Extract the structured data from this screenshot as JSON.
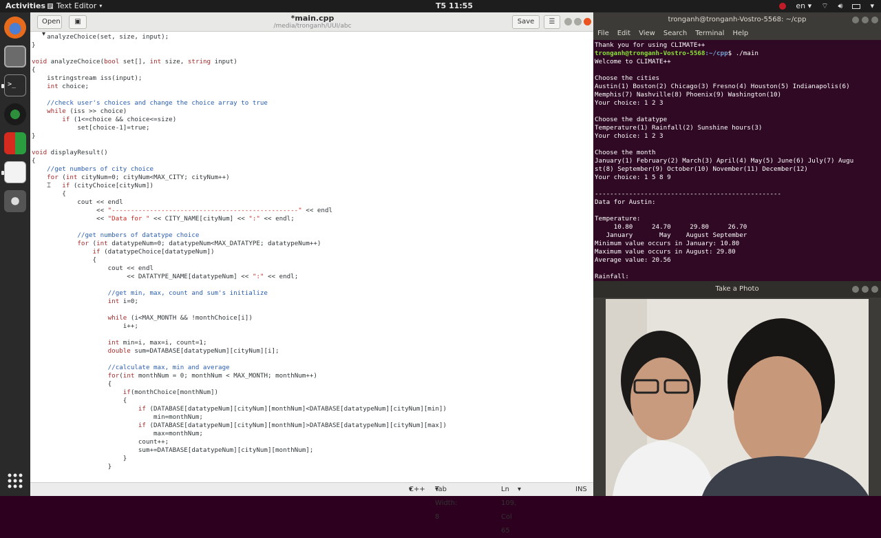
{
  "topbar": {
    "activities": "Activities",
    "app_name": "Text Editor",
    "clock": "T5 11:55",
    "lang": "en"
  },
  "editor": {
    "open_label": "Open",
    "title": "*main.cpp",
    "path": "/media/tronganh/UUI/abc",
    "save_label": "Save",
    "code_lines": [
      "    analyzeChoice(set, size, input);",
      "}",
      "",
      "void analyzeChoice(bool set[], int size, string input)",
      "{",
      "    istringstream iss(input);",
      "    int choice;",
      "",
      "    //check user's choices and change the choice array to true",
      "    while (iss >> choice)",
      "        if (1<=choice && choice<=size)",
      "            set[choice-1]=true;",
      "}",
      "",
      "void displayResult()",
      "{",
      "    //get numbers of city choice",
      "    for (int cityNum=0; cityNum<MAX_CITY; cityNum++)",
      "        if (cityChoice[cityNum])",
      "        {",
      "            cout << endl",
      "                 << \"-------------------------------------------------\" << endl",
      "                 << \"Data for \" << CITY_NAME[cityNum] << \":\" << endl;",
      "",
      "            //get numbers of datatype choice",
      "            for (int datatypeNum=0; datatypeNum<MAX_DATATYPE; datatypeNum++)",
      "                if (datatypeChoice[datatypeNum])",
      "                {",
      "                    cout << endl",
      "                         << DATATYPE_NAME[datatypeNum] << \":\" << endl;",
      "",
      "                    //get min, max, count and sum's initialize",
      "                    int i=0;",
      "",
      "                    while (i<MAX_MONTH && !monthChoice[i])",
      "                        i++;",
      "",
      "                    int min=i, max=i, count=1;",
      "                    double sum=DATABASE[datatypeNum][cityNum][i];",
      "",
      "                    //calculate max, min and average",
      "                    for(int monthNum = 0; monthNum < MAX_MONTH; monthNum++)",
      "                    {",
      "                        if(monthChoice[monthNum])",
      "                        {",
      "                            if (DATABASE[datatypeNum][cityNum][monthNum]<DATABASE[datatypeNum][cityNum][min])",
      "                                min=monthNum;",
      "                            if (DATABASE[datatypeNum][cityNum][monthNum]>DATABASE[datatypeNum][cityNum][max])",
      "                                max=monthNum;",
      "                            count++;",
      "                            sum+=DATABASE[datatypeNum][cityNum][monthNum];",
      "                        }",
      "                    }"
    ],
    "status": {
      "language": "C++",
      "tab_width": "Tab Width: 8",
      "position": "Ln 109, Col 65",
      "mode": "INS"
    }
  },
  "terminal": {
    "title": "tronganh@tronganh-Vostro-5568: ~/cpp",
    "menu": [
      "File",
      "Edit",
      "View",
      "Search",
      "Terminal",
      "Help"
    ],
    "prompt_user": "tronganh@tronganh-Vostro-5568",
    "prompt_dir": ":~/cpp",
    "prompt_cmd": "$ ./main",
    "lines_before_prompt": [
      "Thank you for using CLIMATE++"
    ],
    "lines_after_prompt": [
      "Welcome to CLIMATE++",
      "",
      "Choose the cities",
      "Austin(1) Boston(2) Chicago(3) Fresno(4) Houston(5) Indianapolis(6)",
      "Memphis(7) Nashville(8) Phoenix(9) Washington(10)",
      "Your choice: 1 2 3",
      "",
      "Choose the datatype",
      "Temperature(1) Rainfall(2) Sunshine hours(3)",
      "Your choice: 1 2 3",
      "",
      "Choose the month",
      "January(1) February(2) March(3) April(4) May(5) June(6) July(7) Augu",
      "st(8) September(9) October(10) November(11) December(12)",
      "Your choice: 1 5 8 9",
      "",
      "-------------------------------------------------",
      "Data for Austin:",
      "",
      "Temperature:",
      "     10.80     24.70     29.80     26.70",
      "   January       May    August September",
      "Minimum value occurs in January: 10.80",
      "Maximum value occurs in August: 29.80",
      "Average value: 20.56",
      "",
      "Rainfall:"
    ]
  },
  "photo": {
    "title": "Take a Photo"
  },
  "colors": {
    "comment": "#2a5db0",
    "keyword": "#a52a2a",
    "string": "#c4271f",
    "terminal_bg": "#300a24"
  }
}
